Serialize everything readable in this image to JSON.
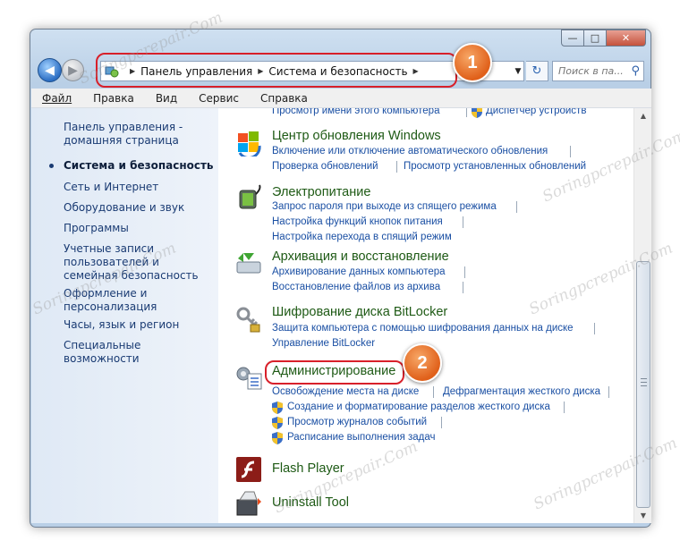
{
  "window": {
    "minimize": "—",
    "maximize": "□",
    "close": "✕"
  },
  "navbar": {
    "breadcrumb": [
      "Панель управления",
      "Система и безопасность"
    ],
    "search_placeholder": "Поиск в па..."
  },
  "menu": [
    "Файл",
    "Правка",
    "Вид",
    "Сервис",
    "Справка"
  ],
  "sidebar": {
    "home": "Панель управления - домашняя страница",
    "items": [
      "Система и безопасность",
      "Сеть и Интернет",
      "Оборудование и звук",
      "Программы",
      "Учетные записи пользователей и семейная безопасность",
      "Оформление и персонализация",
      "Часы, язык и регион",
      "Специальные возможности"
    ]
  },
  "main": {
    "top_links": [
      "Просмотр имени этого компьютера",
      "Диспетчер устройств"
    ],
    "windows_update": {
      "title": "Центр обновления Windows",
      "links": [
        "Включение или отключение автоматического обновления",
        "Проверка обновлений",
        "Просмотр установленных обновлений"
      ]
    },
    "power": {
      "title": "Электропитание",
      "links": [
        "Запрос пароля при выходе из спящего режима",
        "Настройка функций кнопок питания",
        "Настройка перехода в спящий режим"
      ]
    },
    "backup": {
      "title": "Архивация и восстановление",
      "links": [
        "Архивирование данных компьютера",
        "Восстановление файлов из архива"
      ]
    },
    "bitlocker": {
      "title": "Шифрование диска BitLocker",
      "links": [
        "Защита компьютера с помощью шифрования данных на диске",
        "Управление BitLocker"
      ]
    },
    "admin": {
      "title": "Администрирование",
      "links": [
        "Освобождение места на диске",
        "Дефрагментация жесткого диска",
        "Создание и форматирование разделов жесткого диска",
        "Просмотр журналов событий",
        "Расписание выполнения задач"
      ]
    },
    "flash": {
      "title": "Flash Player"
    },
    "uninstall": {
      "title": "Uninstall Tool"
    }
  },
  "callouts": [
    "1",
    "2"
  ],
  "watermark": "Soringpcrepair.Com",
  "colors": {
    "callout_red": "#d8202a",
    "badge_orange": "#e0601a",
    "link_blue": "#1a4fa3",
    "title_green": "#1e5a15"
  }
}
